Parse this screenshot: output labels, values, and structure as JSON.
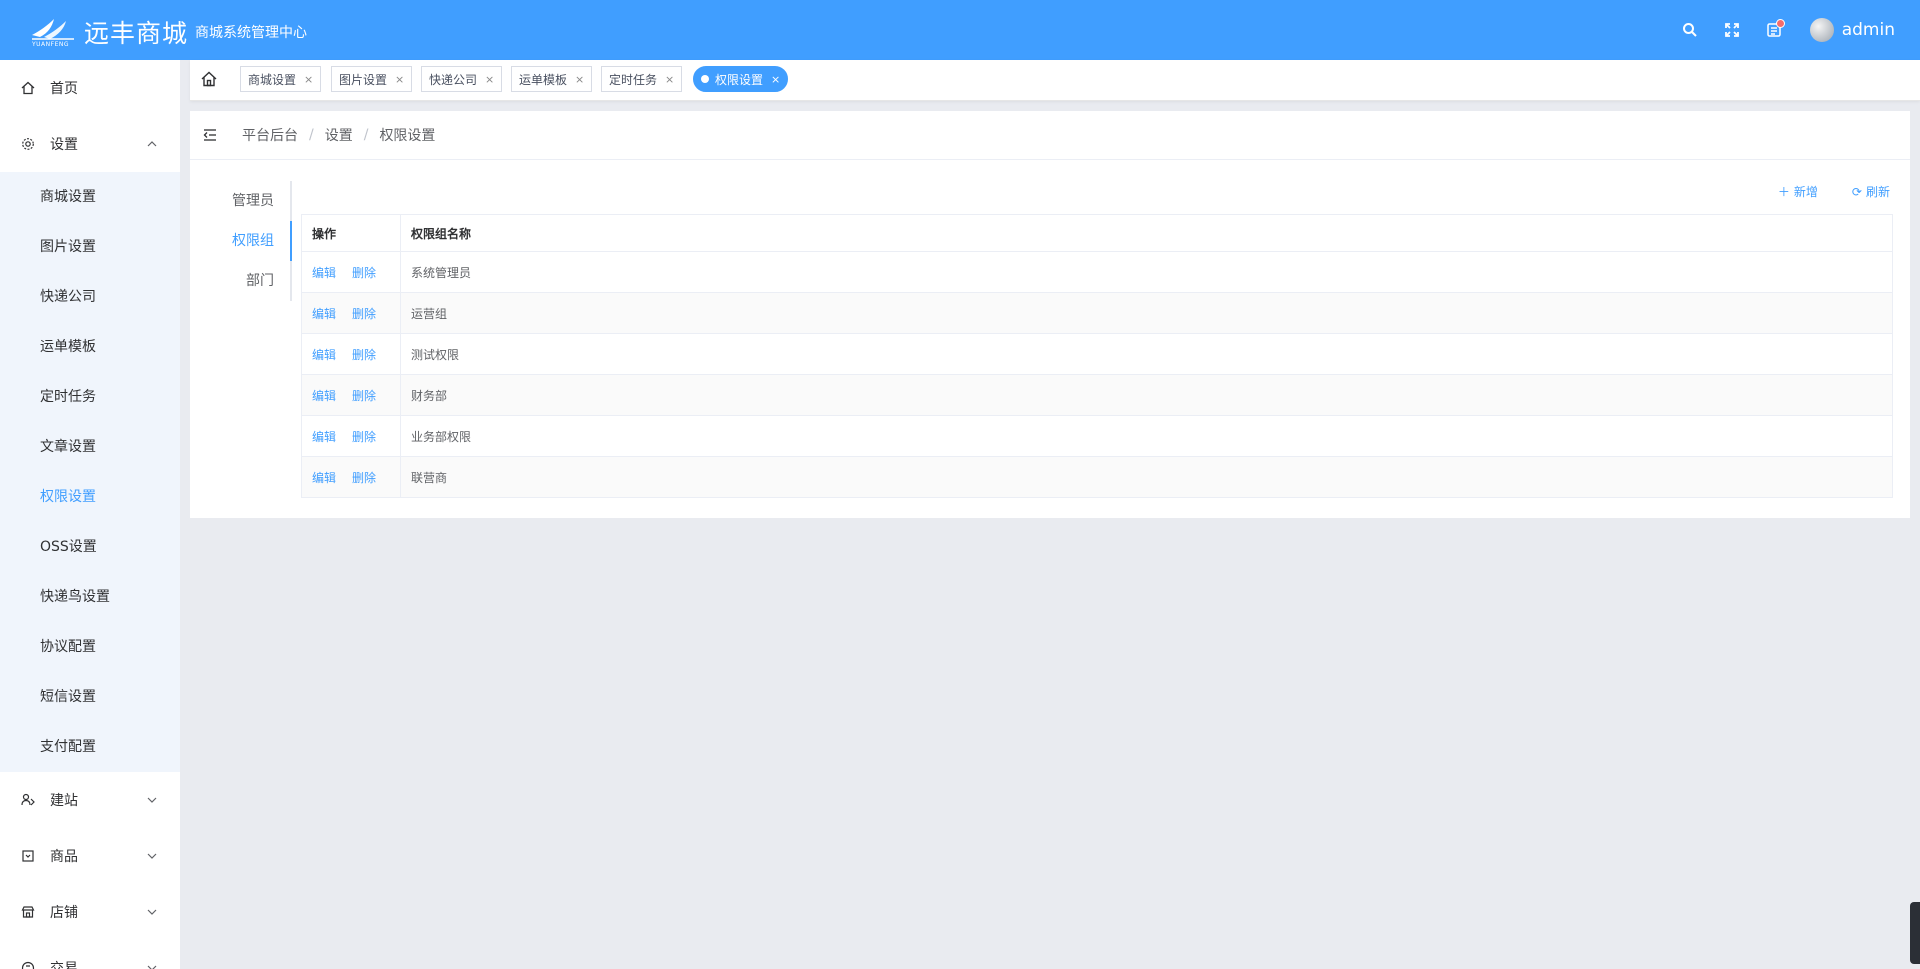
{
  "header": {
    "logo_text": "远丰商城",
    "logo_sub": "YUANFENG",
    "subtitle": "商城系统管理中心",
    "username": "admin",
    "colors": {
      "primary": "#409eff",
      "badge": "#f56c6c"
    },
    "icons": [
      "search-icon",
      "fullscreen-icon",
      "message-icon"
    ]
  },
  "sidebar": {
    "home": "首页",
    "settings": "设置",
    "sub_items": [
      "商城设置",
      "图片设置",
      "快递公司",
      "运单模板",
      "定时任务",
      "文章设置",
      "权限设置",
      "OSS设置",
      "快递鸟设置",
      "协议配置",
      "短信设置",
      "支付配置"
    ],
    "active_sub": "权限设置",
    "build": "建站",
    "goods": "商品",
    "shop": "店铺",
    "trade": "交易"
  },
  "tabs": {
    "items": [
      "商城设置",
      "图片设置",
      "快递公司",
      "运单模板",
      "定时任务",
      "权限设置"
    ],
    "close": "×"
  },
  "breadcrumb": [
    "平台后台",
    "设置",
    "权限设置"
  ],
  "vtabs": [
    "管理员",
    "权限组",
    "部门"
  ],
  "toolbar": {
    "add": "新增",
    "refresh": "刷新"
  },
  "table": {
    "columns": [
      "操作",
      "权限组名称"
    ],
    "edit": "编辑",
    "delete": "删除",
    "rows": [
      "系统管理员",
      "运营组",
      "测试权限",
      "财务部",
      "业务部权限",
      "联营商"
    ]
  }
}
